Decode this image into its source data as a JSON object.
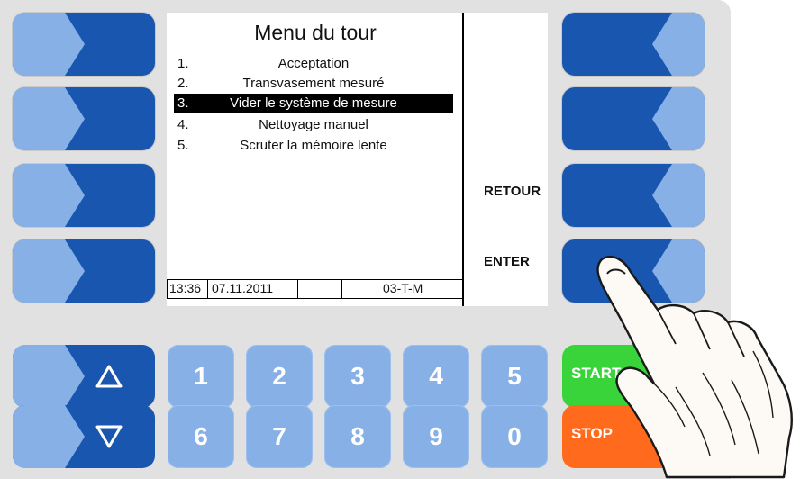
{
  "screen": {
    "title": "Menu du tour",
    "menu": [
      {
        "num": "1.",
        "label": "Acceptation",
        "selected": false
      },
      {
        "num": "2.",
        "label": "Transvasement mesuré",
        "selected": false
      },
      {
        "num": "3.",
        "label": "Vider le système de mesure",
        "selected": true
      },
      {
        "num": "4.",
        "label": "Nettoyage manuel",
        "selected": false
      },
      {
        "num": "5.",
        "label": "Scruter la mémoire lente",
        "selected": false
      }
    ],
    "side_labels": {
      "retour": "RETOUR",
      "enter": "ENTER"
    },
    "status": {
      "time": "13:36",
      "date": "07.11.2011",
      "code": "03-T-M"
    }
  },
  "keypad": {
    "digits_top": [
      "1",
      "2",
      "3",
      "4",
      "5"
    ],
    "digits_bottom": [
      "6",
      "7",
      "8",
      "9",
      "0"
    ],
    "start_label": "START",
    "stop_label": "STOP"
  },
  "icons": {
    "up": "up-triangle-icon",
    "down": "down-triangle-icon",
    "hand": "pointing-hand-icon"
  },
  "colors": {
    "panel": "#e1e1e1",
    "key_light": "#86b0e6",
    "key_dark": "#1856b0",
    "start": "#38d43a",
    "stop": "#ff6a1c",
    "selection": "#000000"
  }
}
